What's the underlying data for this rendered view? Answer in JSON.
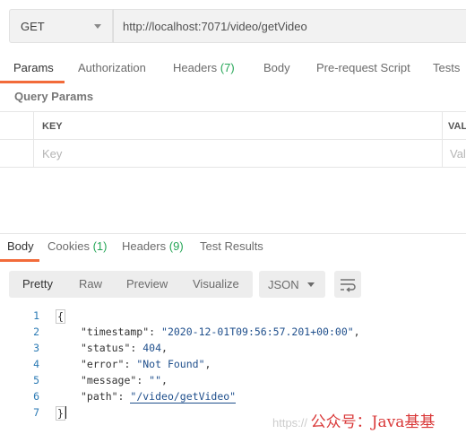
{
  "request": {
    "method": "GET",
    "url": "http://localhost:7071/video/getVideo"
  },
  "request_tabs": [
    {
      "label": "Params"
    },
    {
      "label": "Authorization"
    },
    {
      "label": "Headers",
      "count": "(7)"
    },
    {
      "label": "Body"
    },
    {
      "label": "Pre-request Script"
    },
    {
      "label": "Tests"
    }
  ],
  "query_params": {
    "title": "Query Params",
    "key_header": "KEY",
    "value_header": "VAL",
    "key_placeholder": "Key",
    "value_placeholder": "Val"
  },
  "response_tabs": [
    {
      "label": "Body"
    },
    {
      "label": "Cookies",
      "count": "(1)"
    },
    {
      "label": "Headers",
      "count": "(9)"
    },
    {
      "label": "Test Results"
    }
  ],
  "view_modes": [
    "Pretty",
    "Raw",
    "Preview",
    "Visualize"
  ],
  "format": "JSON",
  "code": {
    "line_numbers": [
      "1",
      "2",
      "3",
      "4",
      "5",
      "6",
      "7"
    ],
    "open_brace": "{",
    "close_brace": "}",
    "fields": [
      {
        "key": "\"timestamp\"",
        "value": "\"2020-12-01T09:56:57.201+00:00\"",
        "trail": ","
      },
      {
        "key": "\"status\"",
        "value": "404",
        "trail": ","
      },
      {
        "key": "\"error\"",
        "value": "\"Not Found\"",
        "trail": ","
      },
      {
        "key": "\"message\"",
        "value": "\"\"",
        "trail": ","
      },
      {
        "key": "\"path\"",
        "value": "\"/video/getVideo\"",
        "trail": ""
      }
    ]
  },
  "watermark": {
    "url": "https://",
    "text": "公众号：Java基基"
  },
  "colors": {
    "accent": "#f26b3a",
    "count_green": "#26a657",
    "json_value": "#1f4f8c"
  }
}
